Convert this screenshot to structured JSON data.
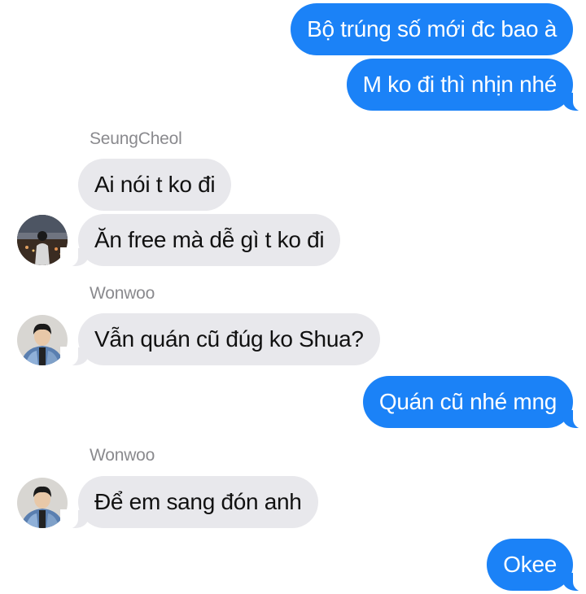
{
  "colors": {
    "outgoing": "#1b82f7",
    "incoming": "#e8e8ec",
    "sender_name": "#8a8a8e"
  },
  "messages": {
    "m1": "Bộ trúng số mới đc bao à",
    "m2": "M ko đi thì nhịn nhé",
    "s1": "SeungCheol",
    "m3": "Ai nói t ko đi",
    "m4": "Ăn free mà dễ gì t ko đi",
    "s2": "Wonwoo",
    "m5": "Vẫn quán cũ đúg ko Shua?",
    "m6": "Quán cũ nhé mng",
    "s3": "Wonwoo",
    "m7": "Để em sang đón anh",
    "m8": "Okee"
  },
  "avatars": {
    "a1": "avatar-seungcheol",
    "a2": "avatar-wonwoo",
    "a3": "avatar-wonwoo"
  }
}
